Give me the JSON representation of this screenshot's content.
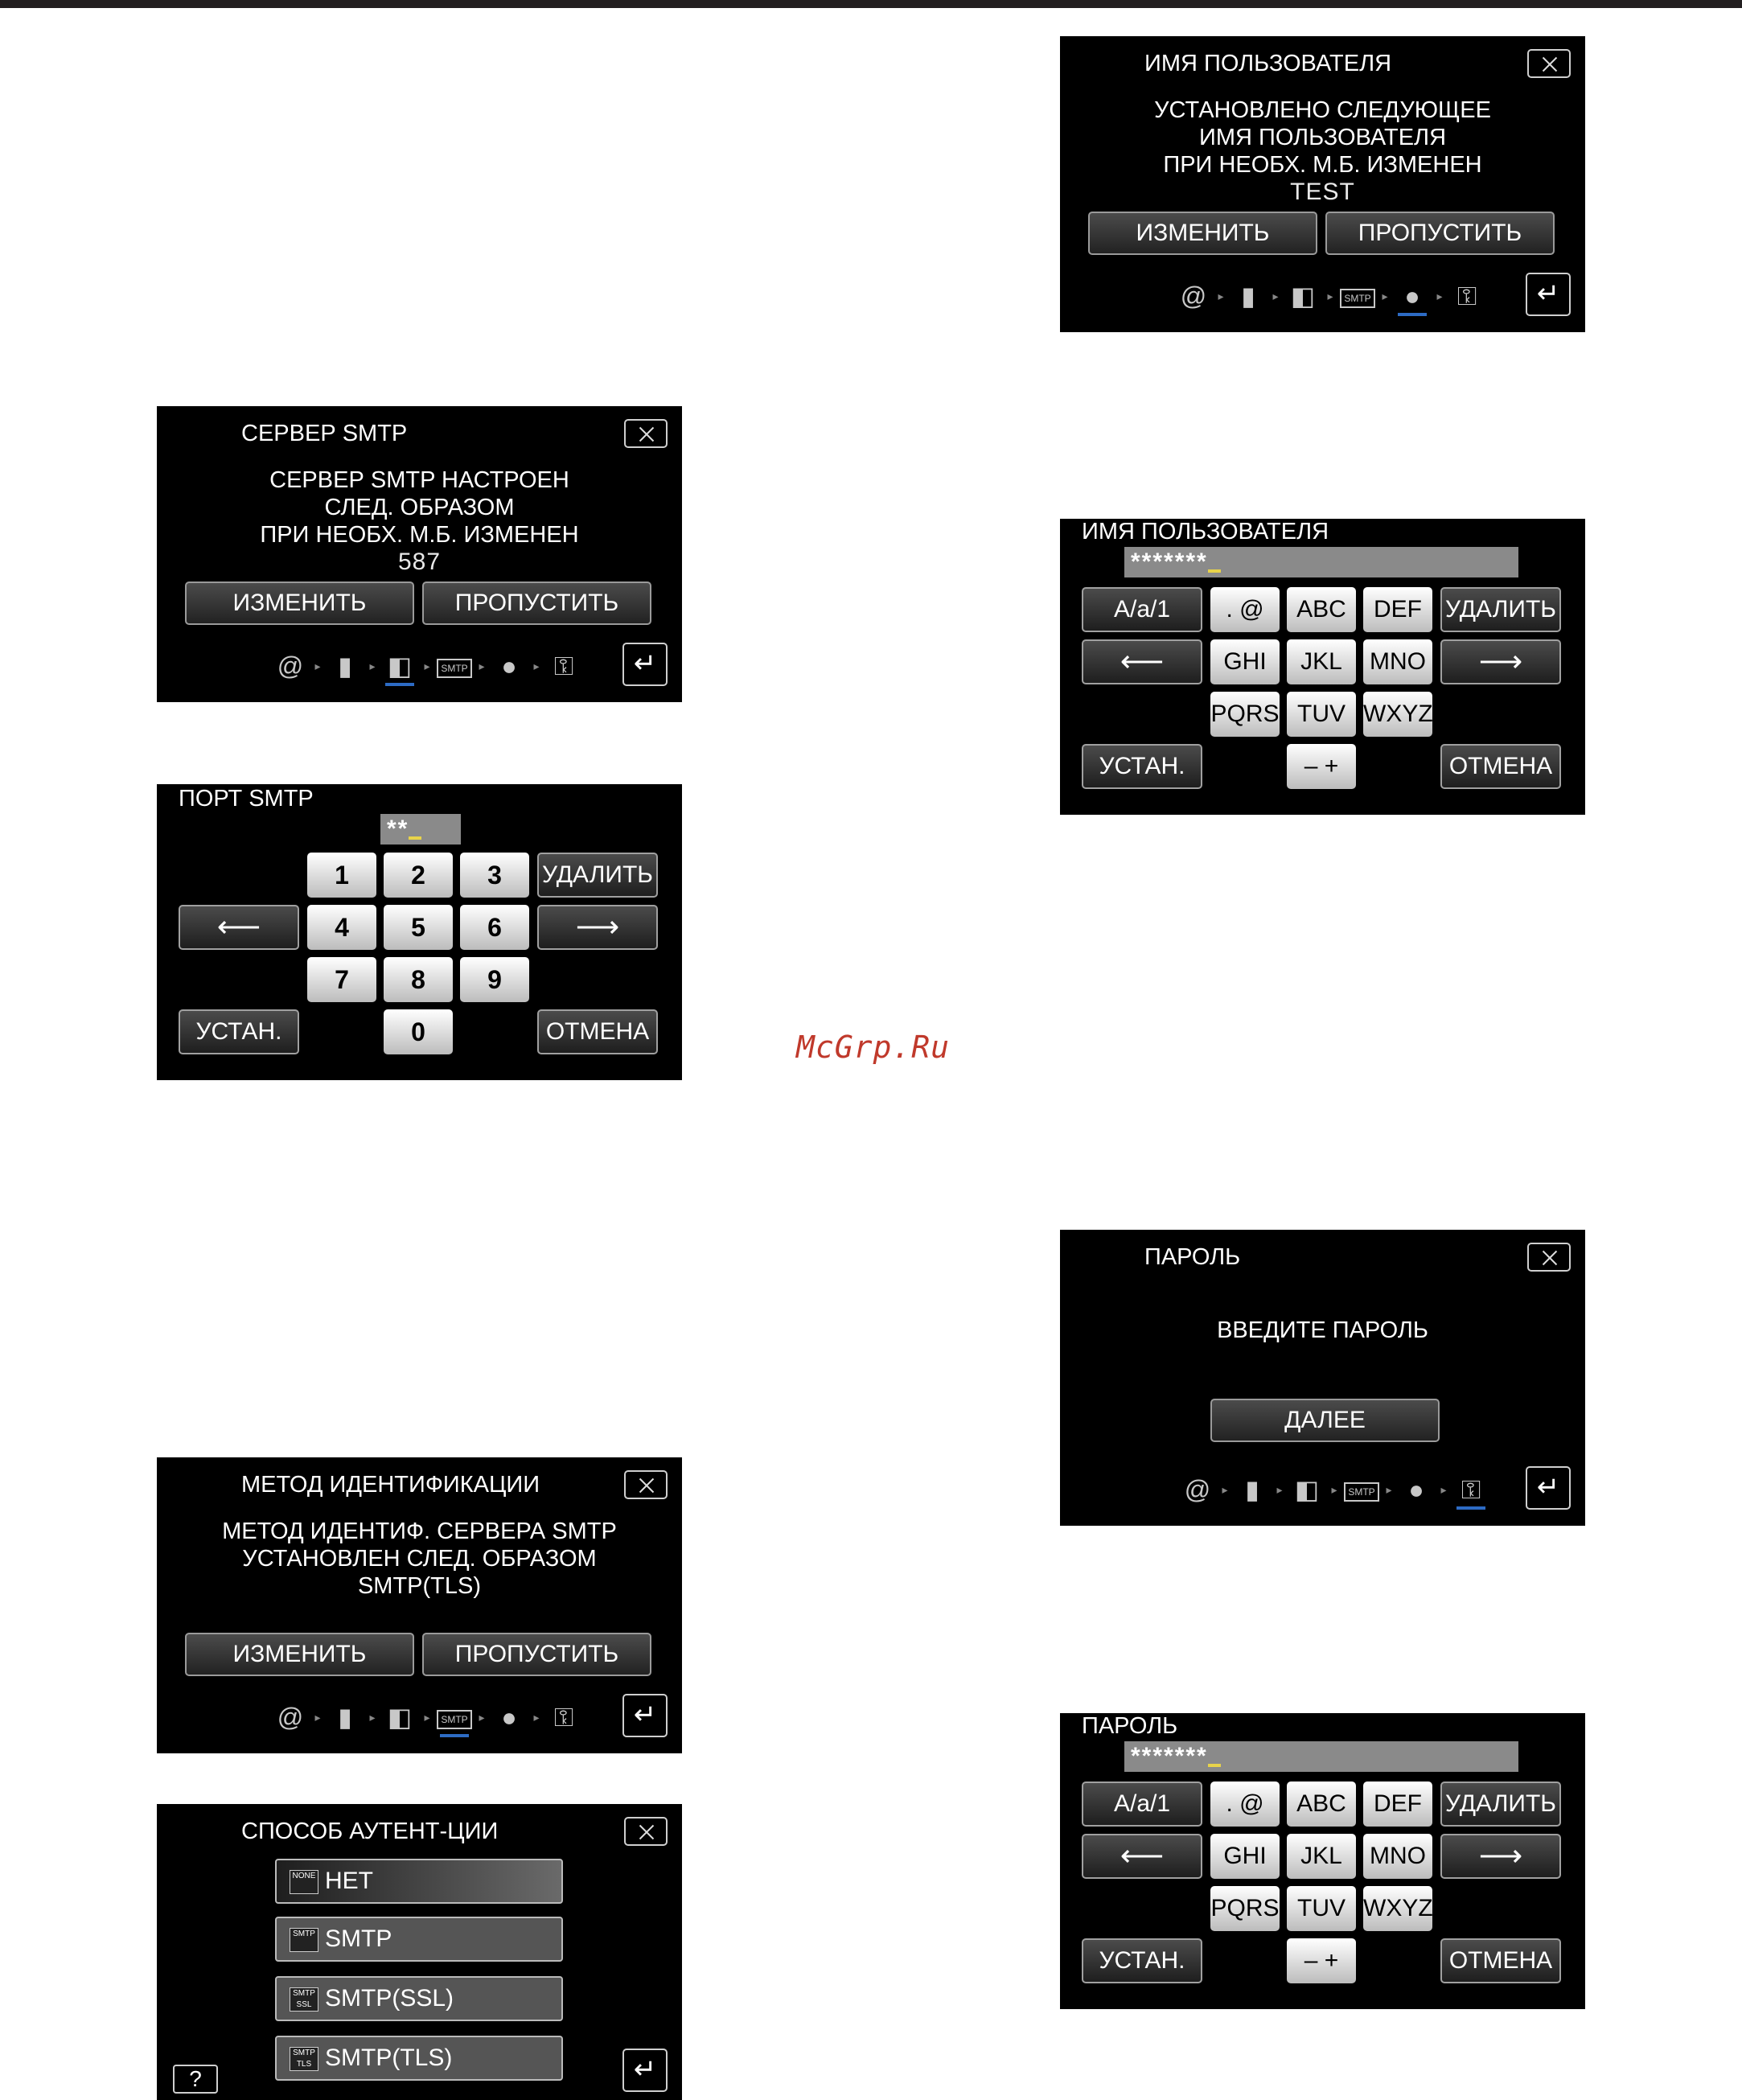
{
  "watermark": "McGrp.Ru",
  "colors": {
    "screen_bg": "#000000",
    "active_step": "#2d6bc4",
    "cursor": "#e8d34a"
  },
  "step_icons": [
    "at-icon",
    "building-icon",
    "door-icon",
    "smtp-icon",
    "user-icon",
    "key-icon"
  ],
  "smtp_mark": "SMTP",
  "smtp_server": {
    "title": "СЕРВЕР SMTP",
    "lines": [
      "СЕРВЕР SMTP НАСТРОЕН",
      "СЛЕД. ОБРАЗОМ",
      "ПРИ НЕОБХ. М.Б. ИЗМЕНЕН"
    ],
    "value": "587",
    "change": "ИЗМЕНИТЬ",
    "skip": "ПРОПУСТИТЬ",
    "active_step": 2
  },
  "smtp_port": {
    "title": "ПОРТ SMTP",
    "input": "**",
    "keys": [
      "1",
      "2",
      "3",
      "4",
      "5",
      "6",
      "7",
      "8",
      "9",
      "0"
    ],
    "delete": "УДАЛИТЬ",
    "set": "УСТАН.",
    "cancel": "ОТМЕНА"
  },
  "auth_method": {
    "title": "МЕТОД ИДЕНТИФИКАЦИИ",
    "lines": [
      "МЕТОД ИДЕНТИФ. СЕРВЕРА SMTP",
      "УСТАНОВЛЕН СЛЕД. ОБРАЗОМ",
      "SMTP(TLS)"
    ],
    "change": "ИЗМЕНИТЬ",
    "skip": "ПРОПУСТИТЬ",
    "active_step": 3
  },
  "auth_type": {
    "title": "СПОСОБ АУТЕНТ-ЦИИ",
    "options": [
      {
        "label": "НЕТ",
        "icon": "NONE"
      },
      {
        "label": "SMTP",
        "icon": "SMTP"
      },
      {
        "label": "SMTP(SSL)",
        "icon": "SMTP SSL"
      },
      {
        "label": "SMTP(TLS)",
        "icon": "SMTP TLS"
      }
    ],
    "help": "?"
  },
  "username_info": {
    "title": "ИМЯ ПОЛЬЗОВАТЕЛЯ",
    "lines": [
      "УСТАНОВЛЕНО СЛЕДУЮЩЕЕ",
      "ИМЯ ПОЛЬЗОВАТЕЛЯ",
      "ПРИ НЕОБХ. М.Б. ИЗМЕНЕН"
    ],
    "value": "TEST",
    "change": "ИЗМЕНИТЬ",
    "skip": "ПРОПУСТИТЬ",
    "active_step": 4
  },
  "username_kb": {
    "title": "ИМЯ ПОЛЬЗОВАТЕЛЯ",
    "input": "*******",
    "mode": "A/a/1",
    "keys_row1": [
      ". @",
      "ABC",
      "DEF"
    ],
    "keys_row2": [
      "GHI",
      "JKL",
      "MNO"
    ],
    "keys_row3": [
      "PQRS",
      "TUV",
      "WXYZ"
    ],
    "minus_plus": "– +",
    "delete": "УДАЛИТЬ",
    "set": "УСТАН.",
    "cancel": "ОТМЕНА"
  },
  "password_info": {
    "title": "ПАРОЛЬ",
    "message": "ВВЕДИТЕ ПАРОЛЬ",
    "next": "ДАЛЕЕ",
    "active_step": 5
  },
  "password_kb": {
    "title": "ПАРОЛЬ",
    "input": "*******",
    "mode": "A/a/1",
    "keys_row1": [
      ". @",
      "ABC",
      "DEF"
    ],
    "keys_row2": [
      "GHI",
      "JKL",
      "MNO"
    ],
    "keys_row3": [
      "PQRS",
      "TUV",
      "WXYZ"
    ],
    "minus_plus": "– +",
    "delete": "УДАЛИТЬ",
    "set": "УСТАН.",
    "cancel": "ОТМЕНА"
  }
}
